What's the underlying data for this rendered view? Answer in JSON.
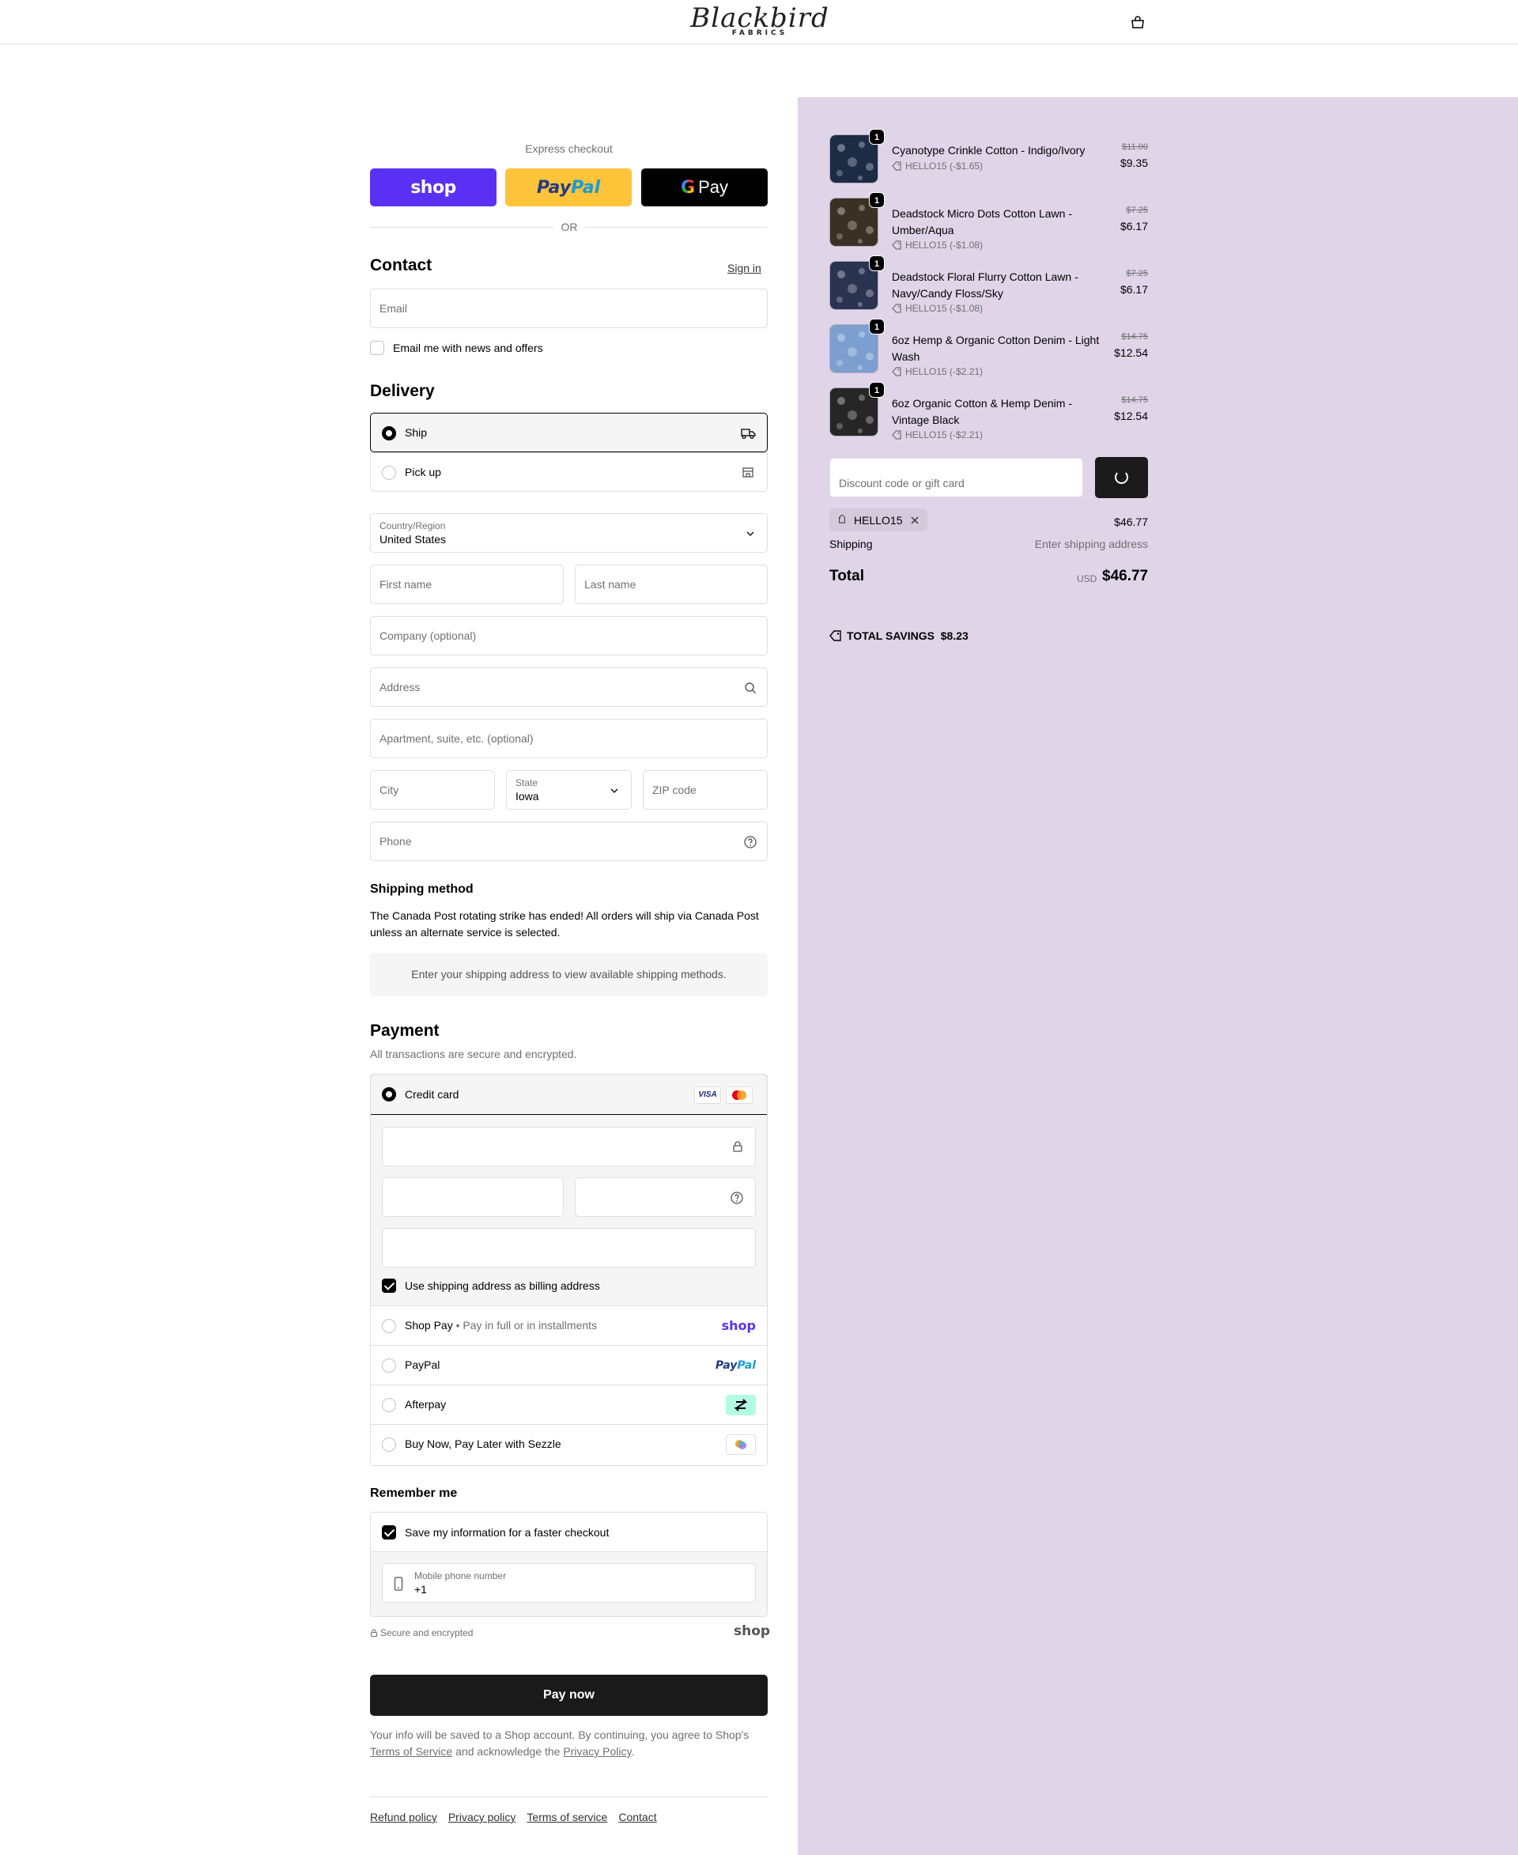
{
  "header": {
    "brand_script": "Blackbird",
    "brand_sub": "FABRICS"
  },
  "express": {
    "label": "Express checkout",
    "shop": "shop",
    "paypal_a": "Pay",
    "paypal_b": "Pal",
    "gpay": "Pay",
    "or": "OR"
  },
  "contact": {
    "heading": "Contact",
    "sign_in": "Sign in",
    "email_placeholder": "Email",
    "news_label": "Email me with news and offers"
  },
  "delivery": {
    "heading": "Delivery",
    "ship": "Ship",
    "pickup": "Pick up",
    "country_label": "Country/Region",
    "country_value": "United States",
    "first_name": "First name",
    "last_name": "Last name",
    "company": "Company (optional)",
    "address": "Address",
    "apartment": "Apartment, suite, etc. (optional)",
    "city": "City",
    "state_label": "State",
    "state_value": "Iowa",
    "zip": "ZIP code",
    "phone": "Phone"
  },
  "shipping_method": {
    "heading": "Shipping method",
    "note": "The Canada Post rotating strike has ended! All orders will ship via Canada Post unless an alternate service is selected.",
    "empty": "Enter your shipping address to view available shipping methods."
  },
  "payment": {
    "heading": "Payment",
    "sub": "All transactions are secure and encrypted.",
    "credit_card": "Credit card",
    "visa": "VISA",
    "billing_same": "Use shipping address as billing address",
    "shop_pay": "Shop Pay",
    "shop_pay_sub": "• Pay in full or in installments",
    "shop_logo": "shop",
    "paypal": "PayPal",
    "paypal_logo_a": "Pay",
    "paypal_logo_b": "Pal",
    "afterpay": "Afterpay",
    "sezzle": "Buy Now, Pay Later with Sezzle"
  },
  "remember": {
    "heading": "Remember me",
    "save_label": "Save my information for a faster checkout",
    "mobile_label": "Mobile phone number",
    "mobile_value": "+1",
    "secure": "Secure and encrypted",
    "shop": "shop"
  },
  "pay_now": "Pay now",
  "legal": {
    "pre": "Your info will be saved to a Shop account. By continuing, you agree to Shop's ",
    "tos": "Terms of Service",
    "mid": " and acknowledge the ",
    "privacy": "Privacy Policy",
    "end": "."
  },
  "footer": {
    "links": [
      "Refund policy",
      "Privacy policy",
      "Terms of service",
      "Contact"
    ]
  },
  "summary": {
    "items": [
      {
        "qty": "1",
        "name": "Cyanotype Crinkle Cotton - Indigo/Ivory",
        "discount": "HELLO15 (-$1.65)",
        "old_price": "$11.00",
        "price": "$9.35",
        "swatch": "#1c2c45"
      },
      {
        "qty": "1",
        "name": "Deadstock Micro Dots Cotton Lawn - Umber/Aqua",
        "discount": "HELLO15 (-$1.08)",
        "old_price": "$7.25",
        "price": "$6.17",
        "swatch": "#3a3124"
      },
      {
        "qty": "1",
        "name": "Deadstock Floral Flurry Cotton Lawn - Navy/Candy Floss/Sky",
        "discount": "HELLO15 (-$1.08)",
        "old_price": "$7.25",
        "price": "$6.17",
        "swatch": "#2a3350"
      },
      {
        "qty": "1",
        "name": "6oz Hemp & Organic Cotton Denim - Light Wash",
        "discount": "HELLO15 (-$2.21)",
        "old_price": "$14.75",
        "price": "$12.54",
        "swatch": "#7d9fd0"
      },
      {
        "qty": "1",
        "name": "6oz Organic Cotton & Hemp Denim - Vintage Black",
        "discount": "HELLO15 (-$2.21)",
        "old_price": "$14.75",
        "price": "$12.54",
        "swatch": "#262626"
      }
    ],
    "discount_placeholder": "Discount code or gift card",
    "code_chip": "HELLO15",
    "subtotal": "$46.77",
    "shipping_label": "Shipping",
    "shipping_value": "Enter shipping address",
    "total_label": "Total",
    "currency": "USD",
    "total": "$46.77",
    "savings_label": "TOTAL SAVINGS",
    "savings_value": "$8.23"
  },
  "colors": {
    "summary_bg": "#e0d4e8",
    "shop_purple": "#5a31f4",
    "paypal_yellow": "#ffc439",
    "dark_button": "#1a1a1a"
  }
}
